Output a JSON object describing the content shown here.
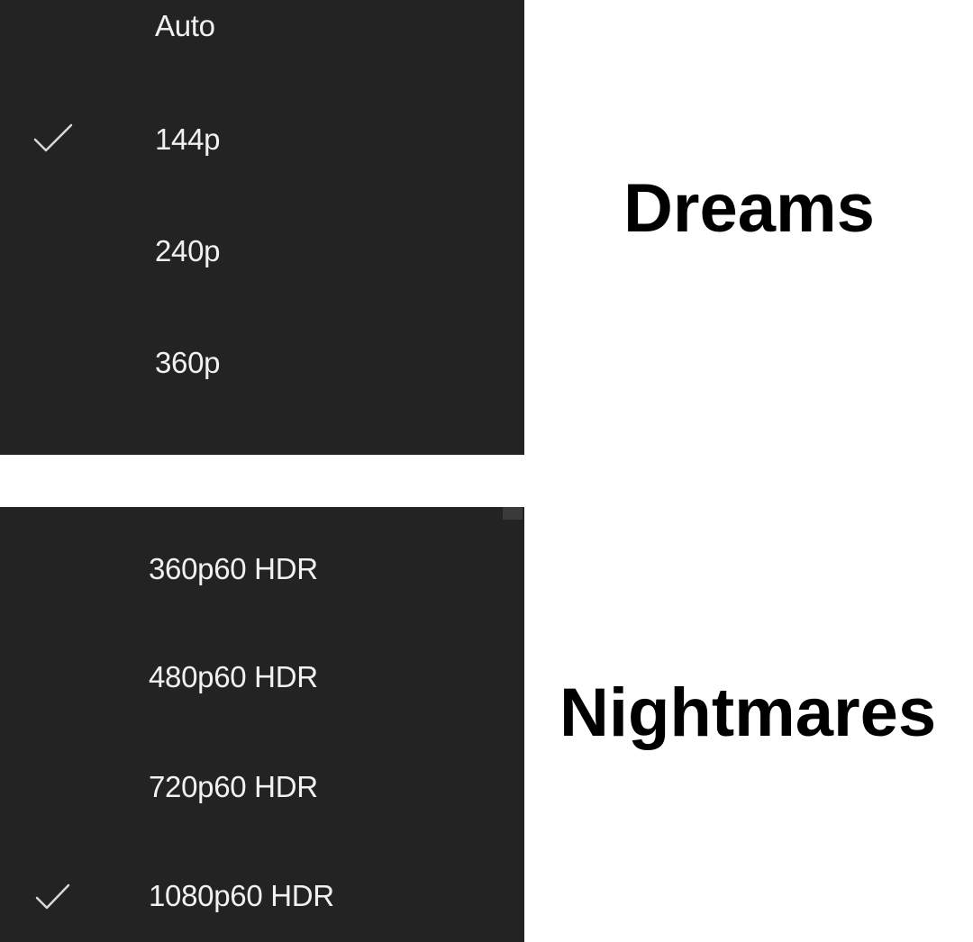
{
  "top_menu": {
    "items": [
      {
        "label": "Auto",
        "checked": false
      },
      {
        "label": "144p",
        "checked": true
      },
      {
        "label": "240p",
        "checked": false
      },
      {
        "label": "360p",
        "checked": false
      }
    ]
  },
  "bottom_menu": {
    "items": [
      {
        "label": "360p60 HDR",
        "checked": false
      },
      {
        "label": "480p60 HDR",
        "checked": false
      },
      {
        "label": "720p60 HDR",
        "checked": false
      },
      {
        "label": "1080p60 HDR",
        "checked": true
      }
    ]
  },
  "captions": {
    "top": "Dreams",
    "bottom": "Nightmares"
  },
  "icons": {
    "selected": "checkmark-icon"
  },
  "colors": {
    "menu_background": "#232323",
    "menu_text": "#f1f1f1",
    "caption_text": "#000000",
    "page_background": "#ffffff"
  }
}
